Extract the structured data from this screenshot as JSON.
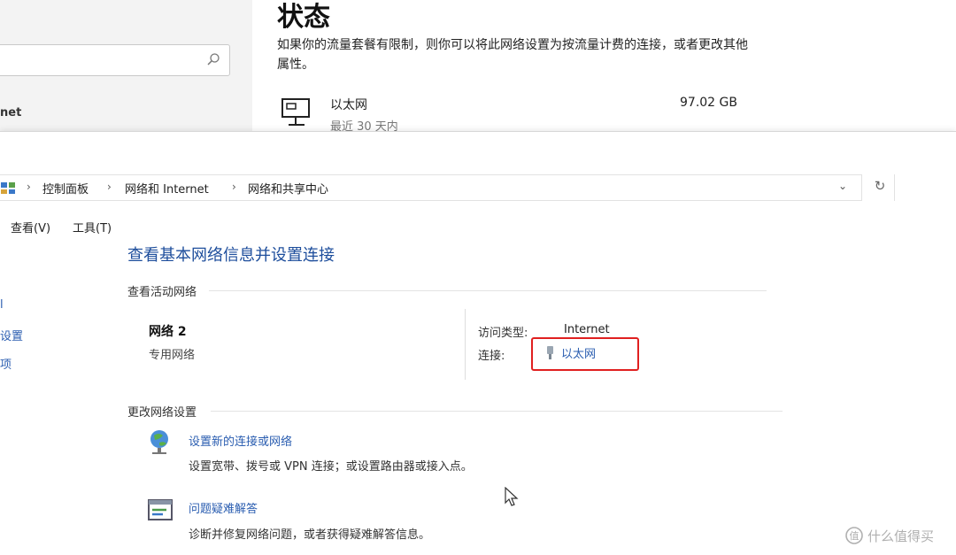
{
  "background_window": {
    "nav_partial_label": "net",
    "status_title": "状态",
    "status_description": "如果你的流量套餐有限制，则你可以将此网络设置为按流量计费的连接，或者更改其他属性。",
    "ethernet": {
      "name": "以太网",
      "subtitle": "最近 30 天内",
      "usage": "97.02 GB"
    }
  },
  "breadcrumb": {
    "items": [
      "控制面板",
      "网络和 Internet",
      "网络和共享中心"
    ],
    "separator": "›"
  },
  "address_controls": {
    "history_glyph": "⌄",
    "refresh_glyph": "↻"
  },
  "menubar": {
    "items": [
      "查看(V)",
      "工具(T)"
    ]
  },
  "left_panel": {
    "links": [
      "l",
      "设置",
      "项"
    ]
  },
  "main": {
    "heading": "查看基本网络信息并设置连接",
    "active_networks": {
      "section_label": "查看活动网络",
      "network_name": "网络 2",
      "network_type": "专用网络",
      "access_type_label": "访问类型:",
      "access_type_value": "Internet",
      "connection_label": "连接:",
      "connection_value": "以太网"
    },
    "change_settings": {
      "section_label": "更改网络设置",
      "tasks": [
        {
          "title": "设置新的连接或网络",
          "description": "设置宽带、拨号或 VPN 连接；或设置路由器或接入点。"
        },
        {
          "title": "问题疑难解答",
          "description": "诊断并修复网络问题，或者获得疑难解答信息。"
        }
      ]
    }
  },
  "watermark": {
    "text": "什么值得买"
  },
  "colors": {
    "link": "#2a5db0",
    "heading": "#1e4e9c",
    "highlight": "#e02020"
  }
}
